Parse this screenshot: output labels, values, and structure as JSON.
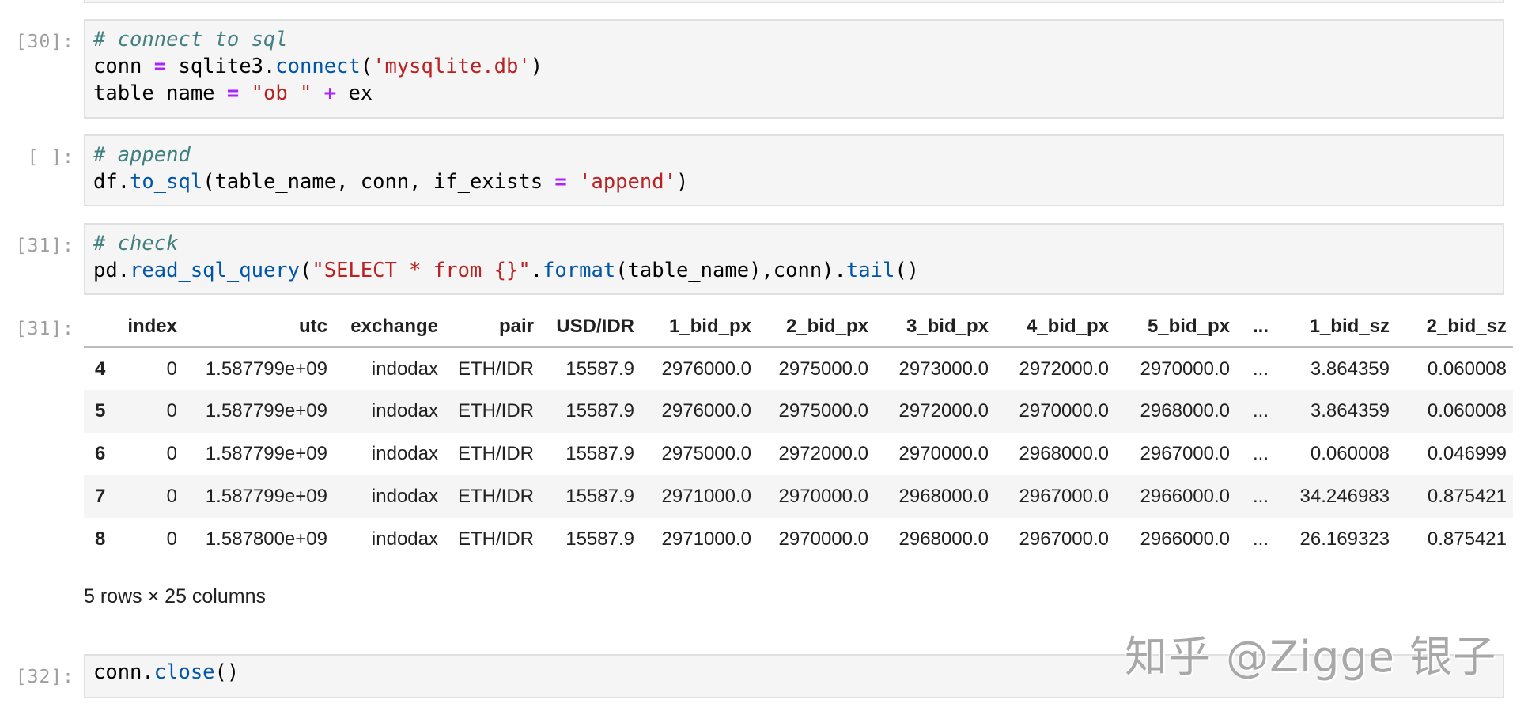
{
  "cells": [
    {
      "prompt": "[30]:",
      "lines": [
        [
          {
            "t": "comment",
            "v": "# connect to sql"
          }
        ],
        [
          {
            "t": "plain",
            "v": "conn "
          },
          {
            "t": "op",
            "v": "="
          },
          {
            "t": "plain",
            "v": " sqlite3."
          },
          {
            "t": "fn",
            "v": "connect"
          },
          {
            "t": "plain",
            "v": "("
          },
          {
            "t": "str",
            "v": "'mysqlite.db'"
          },
          {
            "t": "plain",
            "v": ")"
          }
        ],
        [
          {
            "t": "plain",
            "v": "table_name "
          },
          {
            "t": "op",
            "v": "="
          },
          {
            "t": "plain",
            "v": " "
          },
          {
            "t": "str",
            "v": "\"ob_\""
          },
          {
            "t": "plain",
            "v": " "
          },
          {
            "t": "op",
            "v": "+"
          },
          {
            "t": "plain",
            "v": " ex"
          }
        ]
      ]
    },
    {
      "prompt": "[ ]:",
      "lines": [
        [
          {
            "t": "comment",
            "v": "# append"
          }
        ],
        [
          {
            "t": "plain",
            "v": "df."
          },
          {
            "t": "fn",
            "v": "to_sql"
          },
          {
            "t": "plain",
            "v": "(table_name, conn, if_exists "
          },
          {
            "t": "op",
            "v": "="
          },
          {
            "t": "plain",
            "v": " "
          },
          {
            "t": "str",
            "v": "'append'"
          },
          {
            "t": "plain",
            "v": ")"
          }
        ]
      ]
    },
    {
      "prompt": "[31]:",
      "lines": [
        [
          {
            "t": "comment",
            "v": "# check"
          }
        ],
        [
          {
            "t": "plain",
            "v": "pd."
          },
          {
            "t": "fn",
            "v": "read_sql_query"
          },
          {
            "t": "plain",
            "v": "("
          },
          {
            "t": "str",
            "v": "\"SELECT * from {}\""
          },
          {
            "t": "plain",
            "v": "."
          },
          {
            "t": "fn",
            "v": "format"
          },
          {
            "t": "plain",
            "v": "(table_name),conn)."
          },
          {
            "t": "fn",
            "v": "tail"
          },
          {
            "t": "plain",
            "v": "()"
          }
        ]
      ]
    },
    {
      "prompt": "[32]:",
      "lines": [
        [
          {
            "t": "plain",
            "v": "conn."
          },
          {
            "t": "fn",
            "v": "close"
          },
          {
            "t": "plain",
            "v": "()"
          }
        ]
      ]
    }
  ],
  "output": {
    "prompt": "[31]:",
    "columns": [
      "",
      "index",
      "utc",
      "exchange",
      "pair",
      "USD/IDR",
      "1_bid_px",
      "2_bid_px",
      "3_bid_px",
      "4_bid_px",
      "5_bid_px",
      "...",
      "1_bid_sz",
      "2_bid_sz"
    ],
    "rows": [
      [
        "4",
        "0",
        "1.587799e+09",
        "indodax",
        "ETH/IDR",
        "15587.9",
        "2976000.0",
        "2975000.0",
        "2973000.0",
        "2972000.0",
        "2970000.0",
        "...",
        "3.864359",
        "0.060008"
      ],
      [
        "5",
        "0",
        "1.587799e+09",
        "indodax",
        "ETH/IDR",
        "15587.9",
        "2976000.0",
        "2975000.0",
        "2972000.0",
        "2970000.0",
        "2968000.0",
        "...",
        "3.864359",
        "0.060008"
      ],
      [
        "6",
        "0",
        "1.587799e+09",
        "indodax",
        "ETH/IDR",
        "15587.9",
        "2975000.0",
        "2972000.0",
        "2970000.0",
        "2968000.0",
        "2967000.0",
        "...",
        "0.060008",
        "0.046999"
      ],
      [
        "7",
        "0",
        "1.587799e+09",
        "indodax",
        "ETH/IDR",
        "15587.9",
        "2971000.0",
        "2970000.0",
        "2968000.0",
        "2967000.0",
        "2966000.0",
        "...",
        "34.246983",
        "0.875421"
      ],
      [
        "8",
        "0",
        "1.587800e+09",
        "indodax",
        "ETH/IDR",
        "15587.9",
        "2971000.0",
        "2970000.0",
        "2968000.0",
        "2967000.0",
        "2966000.0",
        "...",
        "26.169323",
        "0.875421"
      ]
    ],
    "summary": "5 rows × 25 columns"
  },
  "watermark": "知乎 @Zigge 银子",
  "colors": {
    "comment": "#408080",
    "operator": "#aa22ff",
    "string": "#ba2121",
    "function": "#0055aa",
    "cell_bg": "#f5f5f5",
    "cell_border": "#e0e0e0",
    "prompt": "#9e9e9e"
  }
}
